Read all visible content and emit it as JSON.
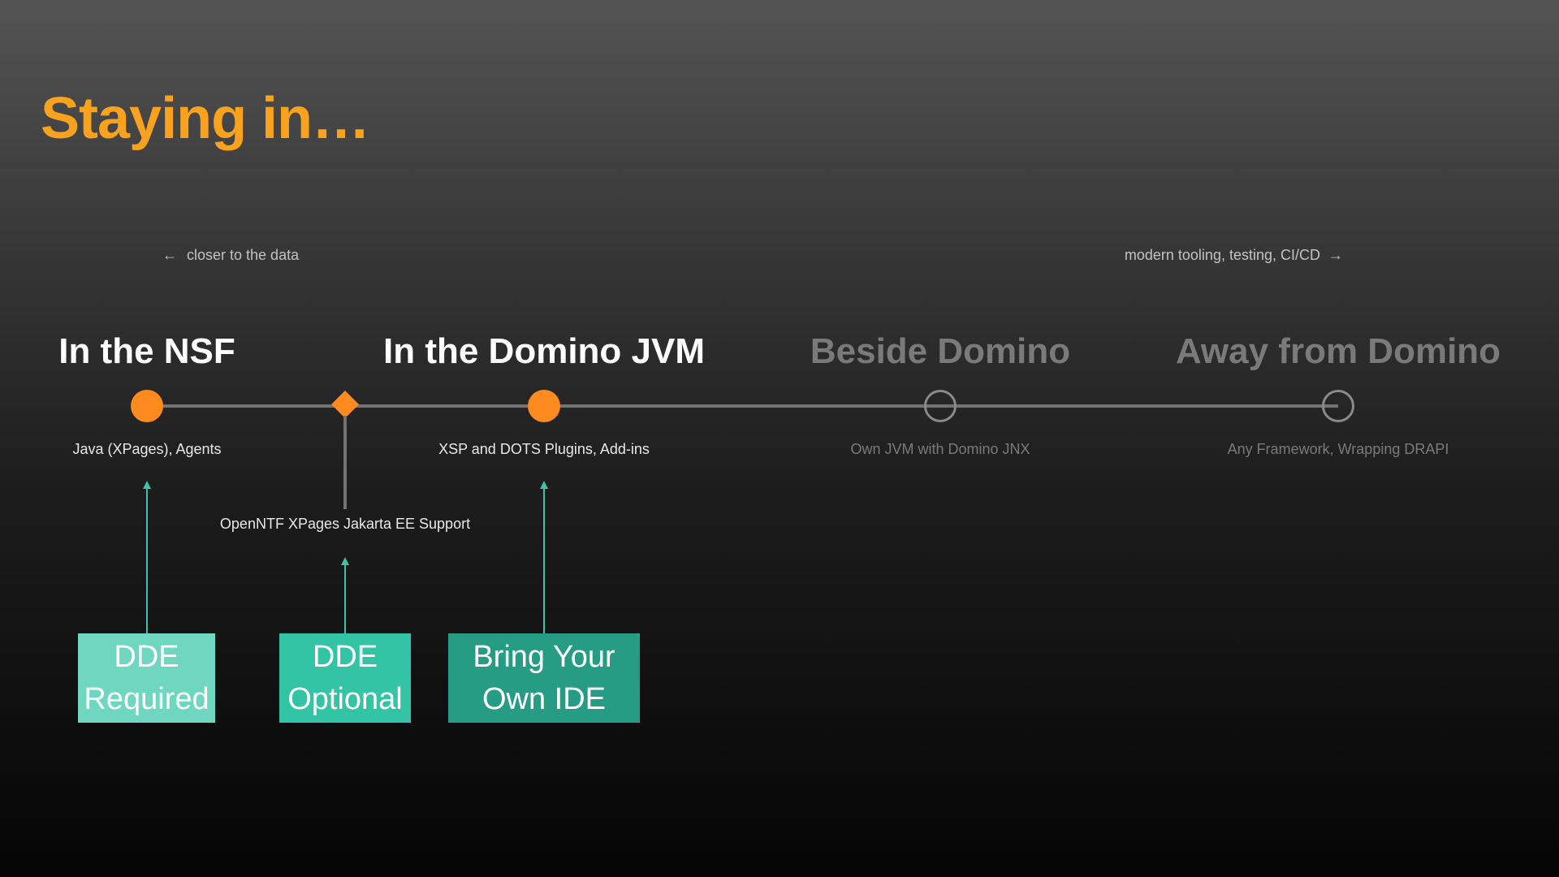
{
  "title": "Staying in…",
  "direction": {
    "left_arrow_icon": "arrow-left-icon",
    "left_label": "closer to the data",
    "right_label": "modern tooling, testing, CI/CD",
    "right_arrow_icon": "arrow-right-icon"
  },
  "stages": [
    {
      "title": "In the NSF",
      "subtitle": "Java (XPages), Agents",
      "active": true
    },
    {
      "title": "In the Domino JVM",
      "subtitle": "XSP and DOTS Plugins, Add-ins",
      "active": true
    },
    {
      "title": "Beside Domino",
      "subtitle": "Own JVM with Domino JNX",
      "active": false
    },
    {
      "title": "Away from Domino",
      "subtitle": "Any Framework, Wrapping DRAPI",
      "active": false
    }
  ],
  "marker": {
    "label": "OpenNTF XPages Jakarta EE Support"
  },
  "boxes": [
    {
      "line1": "DDE",
      "line2": "Required",
      "color": "#6FD6C0"
    },
    {
      "line1": "DDE",
      "line2": "Optional",
      "color": "#33C4A6"
    },
    {
      "line1": "Bring Your",
      "line2": "Own IDE",
      "color": "#269C84"
    }
  ],
  "colors": {
    "accent": "#F8A21E",
    "node_active": "#FF8A1F",
    "arrow": "#3FC2A6",
    "inactive_text": "#7A7A7A"
  }
}
